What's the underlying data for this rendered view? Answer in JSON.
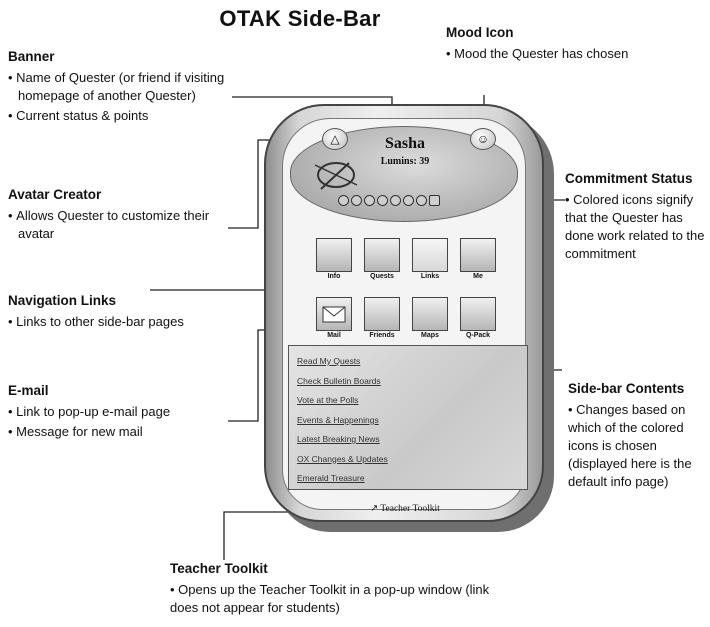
{
  "title": "OTAK Side-Bar",
  "callouts": {
    "banner": {
      "head": "Banner",
      "bullets": [
        "Name of Quester (or friend if visiting homepage of another Quester)",
        "Current status & points"
      ]
    },
    "mood": {
      "head": "Mood Icon",
      "bullets": [
        "Mood the Quester has chosen"
      ]
    },
    "avatar": {
      "head": "Avatar Creator",
      "bullets": [
        "Allows Quester to customize their avatar"
      ]
    },
    "commitment": {
      "head": "Commitment Status",
      "bullets": [
        "Colored icons signify that the Quester has done work related to the commitment"
      ]
    },
    "navigation": {
      "head": "Navigation Links",
      "bullets": [
        "Links to other side-bar pages"
      ]
    },
    "email": {
      "head": "E-mail",
      "bullets": [
        "Link to pop-up e-mail page",
        "Message for new mail"
      ]
    },
    "contents": {
      "head": "Side-bar Contents",
      "bullets": [
        "Changes based on which of the colored icons is chosen (displayed here is the default info page)"
      ]
    },
    "toolkit": {
      "head": "Teacher Toolkit",
      "bullets": [
        "Opens up the Teacher Toolkit in a pop-up window (link does not appear for students)"
      ]
    }
  },
  "device": {
    "name": "Sasha",
    "points": "Lumins: 39",
    "nav_items": [
      "Info",
      "Quests",
      "Links",
      "Me",
      "Mail",
      "Friends",
      "Maps",
      "Q-Pack"
    ],
    "content_links": [
      "Read My Quests",
      "Check Bulletin Boards",
      "Vote at the Polls",
      "Events & Happenings",
      "Latest Breaking News",
      "OX Changes & Updates",
      "Emerald Treasure"
    ],
    "toolkit_label": "Teacher Toolkit"
  }
}
